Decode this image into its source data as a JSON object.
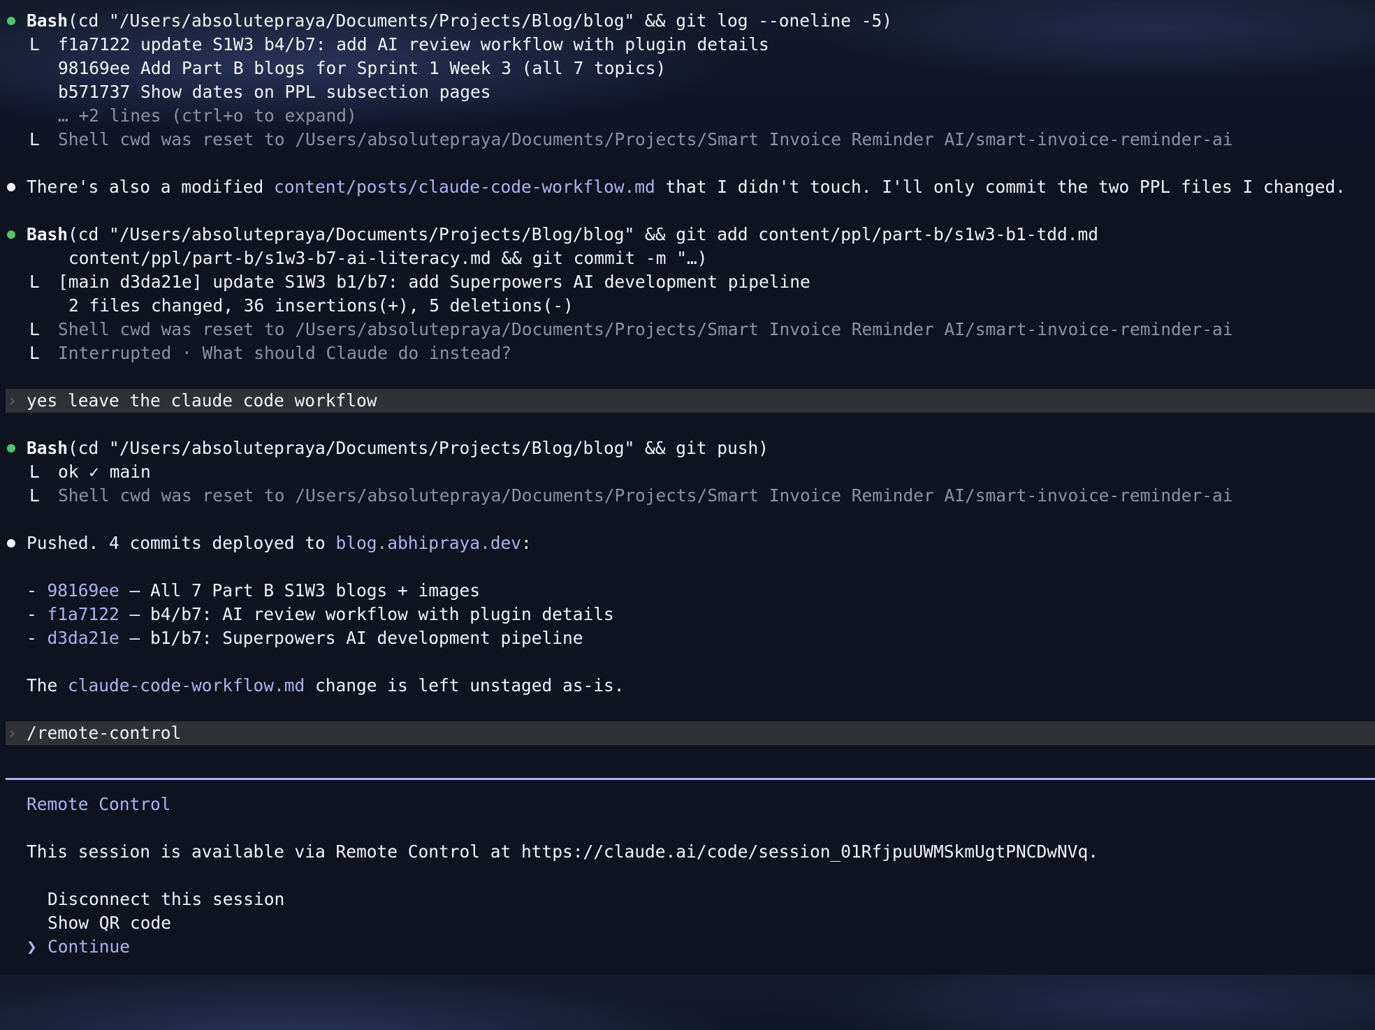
{
  "colors": {
    "success_dot": "#4cc46a",
    "link": "#a9b4f0",
    "dim_text": "#8d92a3",
    "prompt_bar_bg": "#2f3136",
    "divider": "#a9b4f0"
  },
  "block1": {
    "tool": "Bash",
    "command": "(cd \"/Users/absolutepraya/Documents/Projects/Blog/blog\" && git log --oneline -5)",
    "output": [
      "f1a7122 update S1W3 b4/b7: add AI review workflow with plugin details",
      "98169ee Add Part B blogs for Sprint 1 Week 3 (all 7 topics)",
      "b571737 Show dates on PPL subsection pages"
    ],
    "collapsed": "… +2 lines (ctrl+o to expand)",
    "cwd_reset": "Shell cwd was reset to /Users/absolutepraya/Documents/Projects/Smart Invoice Reminder AI/smart-invoice-reminder-ai"
  },
  "note1": {
    "before": "There's also a modified ",
    "file": "content/posts/claude-code-workflow.md",
    "after": " that I didn't touch. I'll only commit the two PPL files I changed."
  },
  "block2": {
    "tool": "Bash",
    "command_line1": "(cd \"/Users/absolutepraya/Documents/Projects/Blog/blog\" && git add content/ppl/part-b/s1w3-b1-tdd.md",
    "command_line2": "content/ppl/part-b/s1w3-b7-ai-literacy.md && git commit -m \"…)",
    "output_line1": "[main d3da21e] update S1W3 b1/b7: add Superpowers AI development pipeline",
    "output_line2": "2 files changed, 36 insertions(+), 5 deletions(-)",
    "cwd_reset": "Shell cwd was reset to /Users/absolutepraya/Documents/Projects/Smart Invoice Reminder AI/smart-invoice-reminder-ai",
    "interrupted": "Interrupted · What should Claude do instead?"
  },
  "prompt1": {
    "chevron": "›",
    "text": "yes leave the claude code workflow"
  },
  "block3": {
    "tool": "Bash",
    "command": "(cd \"/Users/absolutepraya/Documents/Projects/Blog/blog\" && git push)",
    "output": "ok ✓ main",
    "cwd_reset": "Shell cwd was reset to /Users/absolutepraya/Documents/Projects/Smart Invoice Reminder AI/smart-invoice-reminder-ai"
  },
  "summary": {
    "before": "Pushed. 4 commits deployed to ",
    "domain": "blog.abhipraya.dev",
    "after": ":",
    "commits": [
      {
        "hash": "98169ee",
        "desc": " — All 7 Part B S1W3 blogs + images"
      },
      {
        "hash": "f1a7122",
        "desc": " — b4/b7: AI review workflow with plugin details"
      },
      {
        "hash": "d3da21e",
        "desc": " — b1/b7: Superpowers AI development pipeline"
      }
    ],
    "tail_before": "The ",
    "tail_file": "claude-code-workflow.md",
    "tail_after": " change is left unstaged as-is."
  },
  "prompt2": {
    "chevron": "›",
    "text": "/remote-control"
  },
  "remote": {
    "title": "Remote Control",
    "message": "This session is available via Remote Control at https://claude.ai/code/session_01RfjpuUWMSkmUgtPNCDwNVq.",
    "options": [
      "Disconnect this session",
      "Show QR code",
      "Continue"
    ],
    "selected_marker": "❯"
  },
  "tree_glyph": "L",
  "bullet_dash": "-"
}
